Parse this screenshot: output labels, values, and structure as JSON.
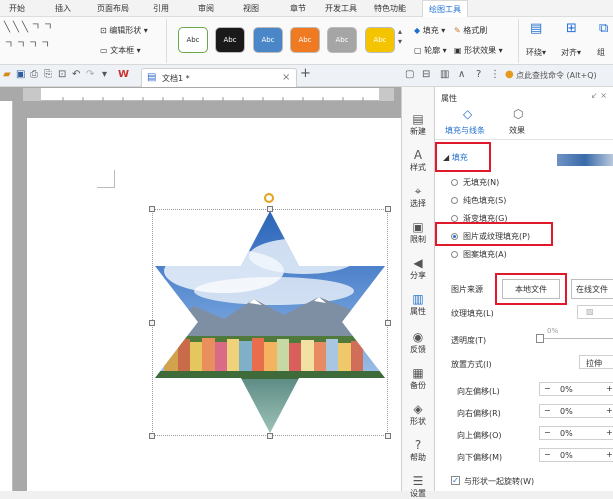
{
  "menu": {
    "tabs": [
      "开始",
      "插入",
      "页面布局",
      "引用",
      "审阅",
      "视图",
      "章节",
      "开发工具",
      "特色功能",
      "绘图工具"
    ],
    "active_tab": "绘图工具"
  },
  "ribbon": {
    "edit_shape": "编辑形状",
    "textbox": "文本框",
    "style_labels": [
      "Abc",
      "Abc",
      "Abc",
      "Abc",
      "Abc",
      "Abc"
    ],
    "fill": "填充",
    "format_brush": "格式刷",
    "outline": "轮廓",
    "shape_effect": "形状效果",
    "wrap": "环绕",
    "align": "对齐",
    "group": "组"
  },
  "colors": {
    "swatch_white": "#ffffff",
    "swatch_black": "#1a1a1a",
    "swatch_blue": "#4a86c8",
    "swatch_orange": "#ef7a22",
    "swatch_gray": "#a5a5a5",
    "swatch_yellow": "#f5c400",
    "accent": "#1f6fd1",
    "highlight": "#e0192b"
  },
  "tabbar": {
    "doc_name": "文档1",
    "modified_mark": "*",
    "close": "×",
    "new_tab": "+",
    "search_hint": "点此查找命令 (Alt+Q)"
  },
  "strip": {
    "items": [
      "新建",
      "样式",
      "选择",
      "限制",
      "分享",
      "属性",
      "反馈",
      "备份",
      "形状",
      "帮助",
      "设置"
    ]
  },
  "panel": {
    "title": "属性",
    "tab_fill_line": "填充与线条",
    "tab_effect": "效果",
    "section_fill": "填充",
    "options": [
      "无填充(N)",
      "纯色填充(S)",
      "渐变填充(G)",
      "图片或纹理填充(P)",
      "图案填充(A)"
    ],
    "selected_option": 3,
    "picture_source_label": "图片来源",
    "local_file_button": "本地文件",
    "online_file_button": "在线文件",
    "texture_fill_label": "纹理填充(L)",
    "transparency_label": "透明度(T)",
    "transparency_value": "0%",
    "placement_label": "放置方式(I)",
    "placement_value": "拉伸",
    "offsets": [
      {
        "label": "向左偏移(L)",
        "value": "0%"
      },
      {
        "label": "向右偏移(R)",
        "value": "0%"
      },
      {
        "label": "向上偏移(O)",
        "value": "0%"
      },
      {
        "label": "向下偏移(M)",
        "value": "0%"
      }
    ],
    "rotate_with_shape": "与形状一起旋转(W)"
  }
}
